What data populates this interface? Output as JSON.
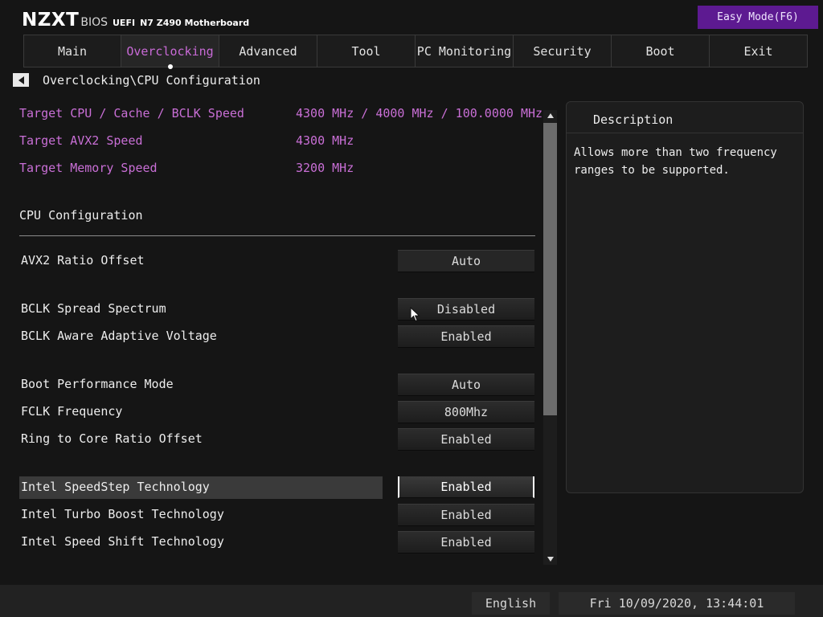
{
  "header": {
    "logo": "NZXT",
    "bios": "BIOS",
    "uefi": "UEFI",
    "board": "N7 Z490 Motherboard",
    "easy_mode": "Easy Mode(F6)"
  },
  "tabs": [
    "Main",
    "Overclocking",
    "Advanced",
    "Tool",
    "PC Monitoring",
    "Security",
    "Boot",
    "Exit"
  ],
  "active_tab": "Overclocking",
  "breadcrumb": "Overclocking\\CPU Configuration",
  "target_info": [
    {
      "label": "Target CPU / Cache / BCLK Speed",
      "value": "4300 MHz / 4000 MHz / 100.0000 MHz"
    },
    {
      "label": "Target AVX2 Speed",
      "value": "4300 MHz"
    },
    {
      "label": "Target Memory Speed",
      "value": "3200 MHz"
    }
  ],
  "section_title": "CPU Configuration",
  "settings": [
    {
      "label": "AVX2 Ratio Offset",
      "value": "Auto"
    },
    {
      "label": "BCLK Spread Spectrum",
      "value": "Disabled"
    },
    {
      "label": "BCLK Aware Adaptive Voltage",
      "value": "Enabled"
    },
    {
      "label": "Boot Performance Mode",
      "value": "Auto"
    },
    {
      "label": "FCLK Frequency",
      "value": "800Mhz"
    },
    {
      "label": "Ring to Core Ratio Offset",
      "value": "Enabled"
    },
    {
      "label": "Intel SpeedStep Technology",
      "value": "Enabled",
      "selected": true
    },
    {
      "label": "Intel Turbo Boost Technology",
      "value": "Enabled"
    },
    {
      "label": "Intel Speed Shift Technology",
      "value": "Enabled"
    }
  ],
  "description": {
    "title": "Description",
    "text": "Allows more than two frequency ranges to be supported."
  },
  "footer": {
    "language": "English",
    "datetime": "Fri 10/09/2020, 13:44:01"
  },
  "colors": {
    "accent": "#c96fd6",
    "easy_mode_bg": "#5d1a91"
  }
}
